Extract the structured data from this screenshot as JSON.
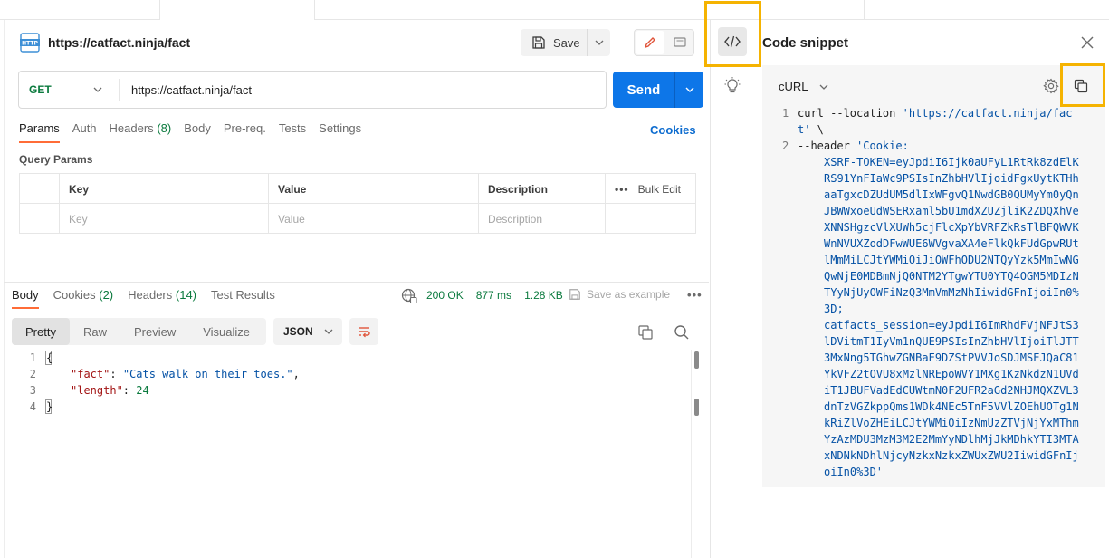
{
  "request": {
    "title": "https://catfact.ninja/fact",
    "save_label": "Save",
    "method": "GET",
    "url": "https://catfact.ninja/fact",
    "send_label": "Send",
    "tabs": {
      "params": "Params",
      "auth": "Auth",
      "headers": "Headers",
      "headers_count": "(8)",
      "body": "Body",
      "prereq": "Pre-req.",
      "tests": "Tests",
      "settings": "Settings"
    },
    "cookies_label": "Cookies",
    "query_params_title": "Query Params",
    "table": {
      "headers": [
        "Key",
        "Value",
        "Description"
      ],
      "bulk_edit": "Bulk Edit",
      "placeholders": [
        "Key",
        "Value",
        "Description"
      ]
    }
  },
  "response": {
    "tabs": {
      "body": "Body",
      "cookies": "Cookies",
      "cookies_count": "(2)",
      "headers": "Headers",
      "headers_count": "(14)",
      "test_results": "Test Results"
    },
    "status": "200 OK",
    "time": "877 ms",
    "size": "1.28 KB",
    "save_example": "Save as example",
    "views": [
      "Pretty",
      "Raw",
      "Preview",
      "Visualize"
    ],
    "format": "JSON",
    "code": {
      "line_numbers": [
        "1",
        "2",
        "3",
        "4"
      ],
      "open_brace": "{",
      "close_brace": "}",
      "fact_key": "\"fact\"",
      "fact_value": "\"Cats walk on their toes.\"",
      "length_key": "\"length\"",
      "length_value": "24"
    }
  },
  "snippet": {
    "title": "Code snippet",
    "language": "cURL",
    "line1_cmd": "curl --location ",
    "line1_url": "'https://catfact.ninja/fact'",
    "line1_tail": " \\",
    "line2_cmd": "--header ",
    "line2_header_start": "'Cookie:",
    "token_xsrf": "XSRF-TOKEN=eyJpdiI6Ijk0aUFyL1RtRk8zdElKRS91YnFIaWc9PSIsInZhbHVlIjoidFgxUytKTHhaaTgxcDZUdUM5dlIxWFgvQ1NwdGB0QUMyYm0yQnJBWWxoeUdWSERxaml5bU1mdXZUZjliK2ZDQXhVeXNNSHgzcVlXUWh5cjFlcXpYbVRFZkRsTlBFQWVKWnNVUXZodDFwWUE6WVgvaXA4eFlkQkFUdGpwRUtlMmMiLCJtYWMiOiJiOWFhODU2NTQyYzk5MmIwNGQwNjE0MDBmNjQ0NTM2YTgwYTU0YTQ4OGM5MDIzNTYyNjUyOWFiNzQ3MmVmMzNhIiwidGFnIjoiIn0%3D;",
    "token_session": "catfacts_session=eyJpdiI6ImRhdFVjNFJtS3lDVitmT1IyVm1nQUE9PSIsInZhbHVlIjoiTlJTT3MxNng5TGhwZGNBaE9DZStPVVJoSDJMSEJQaC81YkVFZ2tOVU8xMzlNREpoWVY1MXg1KzNkdzN1UVdiT1JBUFVadEdCUWtmN0F2UFR2aGd2NHJMQXZVL3dnTzVGZkppQms1WDk4NEc5TnF5VVlZOEhUOTg1NkRiZlVoZHEiLCJtYWMiOiIzNmUzZTVjNjYxMThmYzAzMDU3MzM3M2E2MmYyNDlhMjJkMDhkYTI3MTAxNDNkNDhlNjcyNzkxNzkxZWUxZWU2IiwidGFnIjoiIn0%3D'",
    "line_numbers": [
      "1",
      "2"
    ]
  },
  "colors": {
    "accent_orange": "#ff6c37",
    "send_blue": "#0d76e8",
    "status_green": "#0b7a3e",
    "highlight_yellow": "#f5b301"
  },
  "icons": {
    "http": "http-file-icon",
    "save": "floppy-disk-icon",
    "edit": "pencil-icon",
    "comment": "comment-icon",
    "code": "code-brackets-icon",
    "bulb": "lightbulb-icon",
    "close": "close-icon",
    "gear": "gear-icon",
    "copy": "copy-icon",
    "search": "search-icon",
    "globe": "globe-icon",
    "wrap": "wrap-lines-icon"
  }
}
